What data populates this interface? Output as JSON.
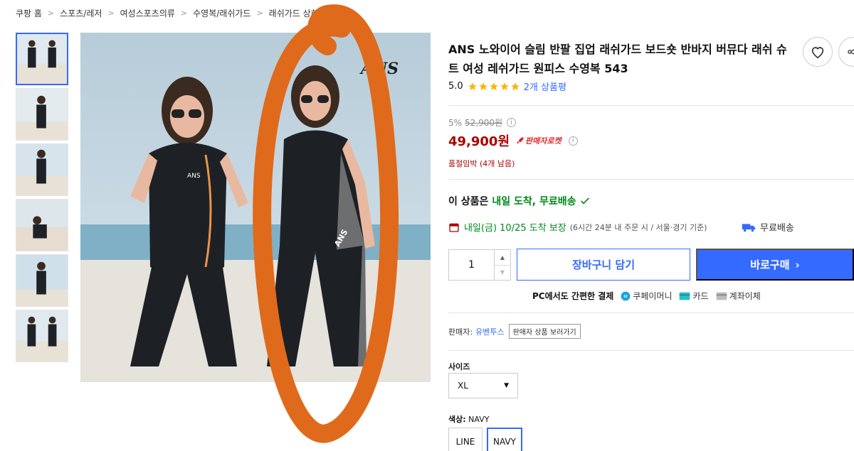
{
  "breadcrumb": [
    "쿠팡 홈",
    "스포츠/레저",
    "여성스포츠의류",
    "수영복/래쉬가드",
    "래쉬가드 상하세"
  ],
  "product": {
    "title": "ANS 노와이어 슬림 반팔 집업 래쉬가드 보드숏 반바지 버뮤다 래쉬 슈트 여성 레쉬가드 원피스 수영복 543",
    "rating": "5.0",
    "review_count": "2개 상품평",
    "image_logo_text": "ANS"
  },
  "price": {
    "discount": "5%",
    "original": "52,900원",
    "info": "i",
    "current": "49,900원",
    "badge": "판매자로켓",
    "stock_notice": "품절임박 (4개 남음)"
  },
  "delivery": {
    "prefix": "이 상품은",
    "highlight": "내일 도착, 무료배송",
    "date": "내일(금) 10/25 도착 보장",
    "detail": "(6시간 24분  내 주문 시 / 서울·경기 기준)",
    "free_shipping": "무료배송"
  },
  "purchase": {
    "quantity": "1",
    "cart_label": "장바구니 담기",
    "buy_label": "바로구매"
  },
  "payment": {
    "label": "PC에서도 간편한 결제",
    "methods": [
      "쿠페이머니",
      "카드",
      "계좌이체"
    ]
  },
  "seller": {
    "label": "판매자:",
    "name": "유벤투스",
    "link": "판매자 상품 보러가기"
  },
  "options": {
    "size_label": "사이즈",
    "size_value": "XL",
    "color_label": "색상:",
    "color_value": "NAVY",
    "colors": [
      "LINE",
      "NAVY"
    ]
  },
  "colors": {
    "accent": "#346aff",
    "price_red": "#ae0000",
    "green": "#00891a",
    "annotation": "#e06a1b"
  }
}
